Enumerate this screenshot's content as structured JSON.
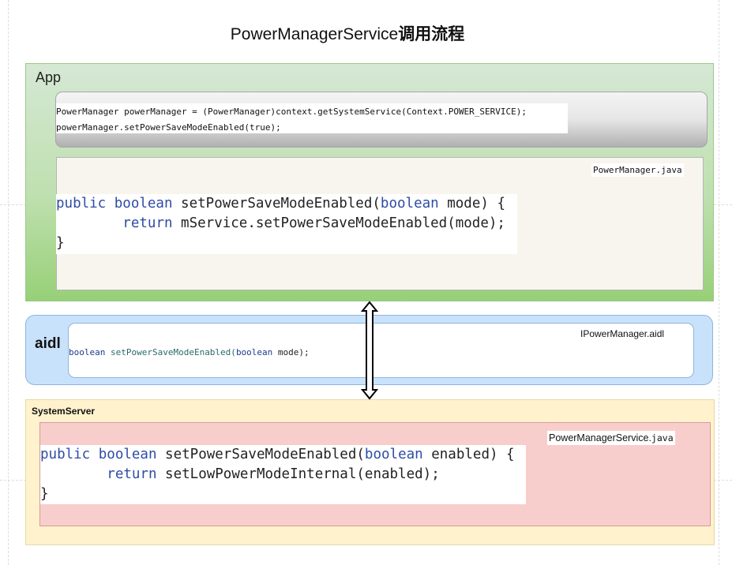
{
  "title": {
    "main": "PowerManagerService",
    "cn": "调用流程"
  },
  "app": {
    "label": "App",
    "snippet_line1": "PowerManager powerManager = (PowerManager)context.getSystemService(Context.POWER_SERVICE);",
    "snippet_line2": "powerManager.setPowerSaveModeEnabled(true);",
    "file": "PowerManager.java",
    "code": {
      "l1_kw": "public boolean",
      "l1_rest": " setPowerSaveModeEnabled(",
      "l1_kw2": "boolean",
      "l1_end": " mode) {",
      "l2_indent": "        ",
      "l2_kw": "return",
      "l2_rest": " mService.setPowerSaveModeEnabled(mode);",
      "l3": "}"
    }
  },
  "aidl": {
    "label": "aidl",
    "file": "IPowerManager.aidl",
    "code": {
      "kw": "boolean",
      "fn": " setPowerSaveModeEnabled(",
      "kw2": "boolean",
      "end": " mode);"
    }
  },
  "systemserver": {
    "label": "SystemServer",
    "file_name": "PowerManagerService.",
    "file_ext": "java",
    "code": {
      "l1_kw": "public boolean",
      "l1_rest": " setPowerSaveModeEnabled(",
      "l1_kw2": "boolean",
      "l1_end": " enabled) {",
      "l2_indent": "        ",
      "l2_kw": "return",
      "l2_rest": " setLowPowerModeInternal(enabled);",
      "l3": "}"
    }
  },
  "colors": {
    "app_fill": "#d5e8d4",
    "aidl_fill": "#c9e2fb",
    "systemserver_fill": "#fff2cc",
    "service_fill": "#f8cecc",
    "keyword": "#2e4ca6"
  },
  "icons": [
    "double-arrow-icon"
  ]
}
